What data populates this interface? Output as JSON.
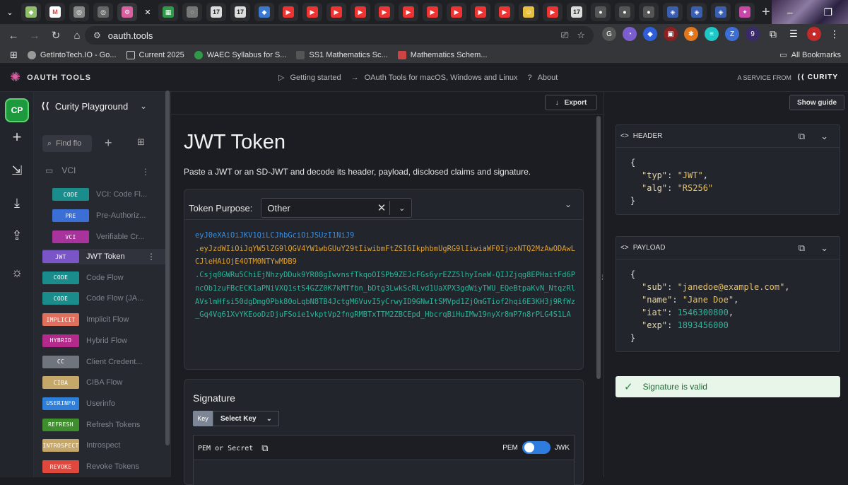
{
  "browser": {
    "url": "oauth.tools",
    "bookmarks": [
      "GetIntoTech.IO - Go...",
      "Current 2025",
      "WAEC Syllabus for S...",
      "SS1 Mathematics Sc...",
      "Mathematics Schem..."
    ],
    "all_bookmarks": "All Bookmarks",
    "ext_badge": "9"
  },
  "app": {
    "brand": "OAUTH TOOLS",
    "nav": [
      "Getting started",
      "OAuth Tools for macOS, Windows and Linux",
      "About"
    ],
    "service_from": "A SERVICE FROM",
    "curity": "CURITY"
  },
  "rail": {
    "avatar": "CP"
  },
  "sidebar": {
    "workspace": "Curity Playground",
    "find_placeholder": "Find flo",
    "folder": "VCI",
    "vci_items": [
      {
        "chip": "CODE",
        "label": "VCI: Code Fl...",
        "color": "#1a8c8c"
      },
      {
        "chip": "PRE",
        "label": "Pre-Authoriz...",
        "color": "#3b6fd6"
      },
      {
        "chip": "VCI",
        "label": "Verifiable Cr...",
        "color": "#a8339c"
      }
    ],
    "items": [
      {
        "chip": "JWT",
        "label": "JWT Token",
        "color": "#7a55c8"
      },
      {
        "chip": "CODE",
        "label": "Code Flow",
        "color": "#1a8c8c"
      },
      {
        "chip": "CODE",
        "label": "Code Flow (JA...",
        "color": "#1a8c8c"
      },
      {
        "chip": "IMPLICIT",
        "label": "Implicit Flow",
        "color": "#e0705e"
      },
      {
        "chip": "HYBRID",
        "label": "Hybrid Flow",
        "color": "#b32a8a"
      },
      {
        "chip": "CC",
        "label": "Client Credent...",
        "color": "#6f747d"
      },
      {
        "chip": "CIBA",
        "label": "CIBA Flow",
        "color": "#c6a76a"
      },
      {
        "chip": "USERINFO",
        "label": "Userinfo",
        "color": "#2d7fd9"
      },
      {
        "chip": "REFRESH",
        "label": "Refresh Tokens",
        "color": "#3f8e2e"
      },
      {
        "chip": "INTROSPECT",
        "label": "Introspect",
        "color": "#c6a76a"
      },
      {
        "chip": "REVOKE",
        "label": "Revoke Tokens",
        "color": "#e0483e"
      }
    ]
  },
  "main": {
    "export": "Export",
    "title": "JWT Token",
    "subtitle": "Paste a JWT or an SD-JWT and decode its header, payload, disclosed claims and signature.",
    "purpose_label": "Token Purpose:",
    "purpose_value": "Other",
    "token_header": "eyJ0eXAiOiJKV1QiLCJhbGciOiJSUzI1NiJ9",
    "token_payload": ".eyJzdWIiOiJqYW5lZG9lQGV4YW1wbGUuY29tIiwibmFtZSI6IkphbmUgRG9lIiwiaWF0IjoxNTQ2MzAwODAwLCJleHAiOjE4OTM0NTYwMDB9",
    "token_signature": ".Csjq0GWRu5ChiEjNhzyDDuk9YR08gIwvnsfTkqoOISPb9ZEJcFGs6yrEZZ5lhyIneW-QIJZjqg8EPHaitFd6PncOb1zuFBcECK1aPNiVXQ1stS4GZZ0K7kMTfbn_bDtg3LwkScRLvd1UaXPX3gdWiyTWU_EQeBtpaKvN_NtqzRlAVslmHfsi50dgDmg0Pbk80oLqbN8TB4JctgM6VuvI5yCrwyID9GNwItSMVpd1ZjOmGTiof2hqi6E3KH3j9RfWz_Gq4Vq61XvYKEooDzDjuFSoie1vkptVp2fngRMBTxTTM2ZBCEpd_HbcrqBiHuIMw19nyXr8mP7n8rPLG4S1LA",
    "signature_title": "Signature",
    "key_chip": "Key",
    "select_key": "Select Key",
    "pem_label": "PEM or Secret",
    "pem": "PEM",
    "jwk": "JWK"
  },
  "right": {
    "show_guide": "Show guide",
    "header_title": "HEADER",
    "payload_title": "PAYLOAD",
    "header_json": [
      {
        "k": "\"typ\"",
        "v": "\"JWT\"",
        "t": "str"
      },
      {
        "k": "\"alg\"",
        "v": "\"RS256\"",
        "t": "str"
      }
    ],
    "payload_json": [
      {
        "k": "\"sub\"",
        "v": "\"janedoe@example.com\"",
        "t": "str"
      },
      {
        "k": "\"name\"",
        "v": "\"Jane Doe\"",
        "t": "str"
      },
      {
        "k": "\"iat\"",
        "v": "1546300800",
        "t": "num"
      },
      {
        "k": "\"exp\"",
        "v": "1893456000",
        "t": "num"
      }
    ],
    "valid": "Signature is valid"
  }
}
